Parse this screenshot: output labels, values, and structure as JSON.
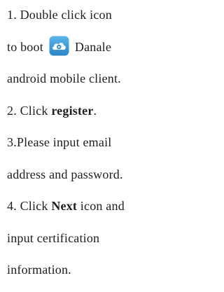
{
  "instructions": {
    "line1": "1. Double click icon",
    "line2_before": "to boot",
    "line2_after": "Danale",
    "line3": "android mobile client.",
    "step2_prefix": "2. Click ",
    "step2_bold": "register",
    "step2_suffix": ".",
    "line5": "3.Please input email",
    "line6": "address and password.",
    "step4_prefix": "4.  Click ",
    "step4_bold": "Next",
    "step4_suffix": " icon and",
    "line8": "input certification",
    "line9": "information."
  },
  "icon": {
    "name": "danale-app-icon",
    "color": "#3d9ad6"
  }
}
